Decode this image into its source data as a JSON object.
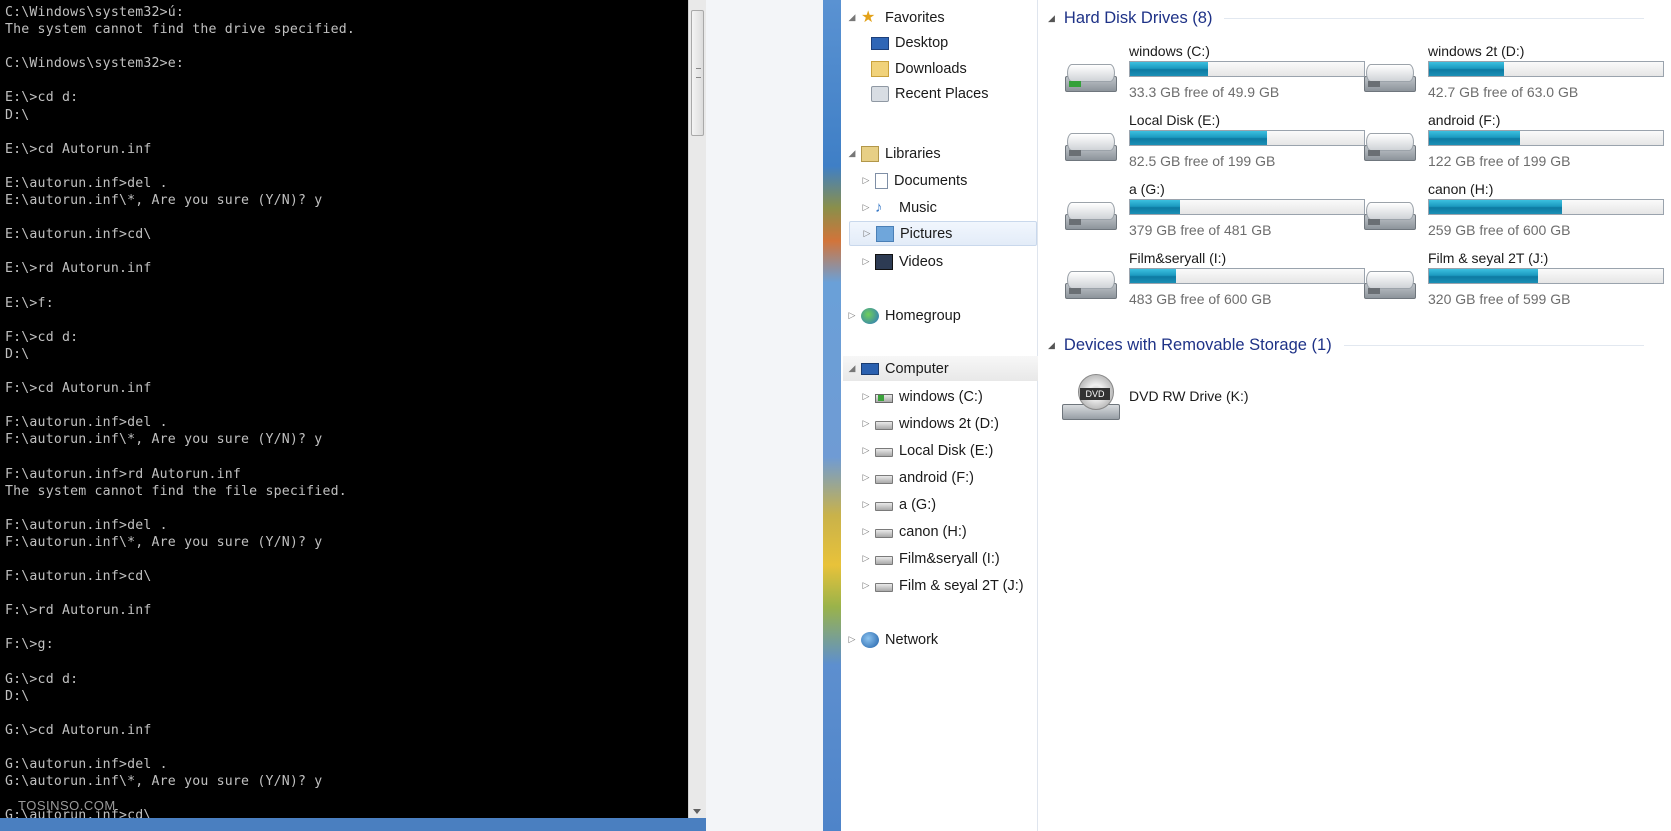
{
  "console": {
    "lines": [
      "C:\\Windows\\system32>ú:",
      "The system cannot find the drive specified.",
      "",
      "C:\\Windows\\system32>e:",
      "",
      "E:\\>cd d:",
      "D:\\",
      "",
      "E:\\>cd Autorun.inf",
      "",
      "E:\\autorun.inf>del .",
      "E:\\autorun.inf\\*, Are you sure (Y/N)? y",
      "",
      "E:\\autorun.inf>cd\\",
      "",
      "E:\\>rd Autorun.inf",
      "",
      "E:\\>f:",
      "",
      "F:\\>cd d:",
      "D:\\",
      "",
      "F:\\>cd Autorun.inf",
      "",
      "F:\\autorun.inf>del .",
      "F:\\autorun.inf\\*, Are you sure (Y/N)? y",
      "",
      "F:\\autorun.inf>rd Autorun.inf",
      "The system cannot find the file specified.",
      "",
      "F:\\autorun.inf>del .",
      "F:\\autorun.inf\\*, Are you sure (Y/N)? y",
      "",
      "F:\\autorun.inf>cd\\",
      "",
      "F:\\>rd Autorun.inf",
      "",
      "F:\\>g:",
      "",
      "G:\\>cd d:",
      "D:\\",
      "",
      "G:\\>cd Autorun.inf",
      "",
      "G:\\autorun.inf>del .",
      "G:\\autorun.inf\\*, Are you sure (Y/N)? y",
      "",
      "G:\\autorun.inf>cd\\"
    ],
    "watermark": "TOSINSO.COM"
  },
  "nav": {
    "favorites": {
      "label": "Favorites",
      "items": [
        "Desktop",
        "Downloads",
        "Recent Places"
      ]
    },
    "libraries": {
      "label": "Libraries",
      "items": [
        "Documents",
        "Music",
        "Pictures",
        "Videos"
      ]
    },
    "homegroup": "Homegroup",
    "computer": {
      "label": "Computer",
      "items": [
        "windows (C:)",
        "windows 2t (D:)",
        "Local Disk (E:)",
        "android (F:)",
        "a (G:)",
        "canon (H:)",
        "Film&seryall (I:)",
        "Film & seyal 2T (J:)"
      ]
    },
    "network": "Network"
  },
  "content": {
    "hdd_group": "Hard Disk Drives (8)",
    "drives": [
      {
        "name": "windows (C:)",
        "free_text": "33.3 GB free of 49.9 GB",
        "used_fraction": 0.333
      },
      {
        "name": "windows 2t (D:)",
        "free_text": "42.7 GB free of 63.0 GB",
        "used_fraction": 0.322
      },
      {
        "name": "Local Disk (E:)",
        "free_text": "82.5 GB free of 199 GB",
        "used_fraction": 0.585
      },
      {
        "name": "android (F:)",
        "free_text": "122 GB free of 199 GB",
        "used_fraction": 0.387
      },
      {
        "name": "a (G:)",
        "free_text": "379 GB free of 481 GB",
        "used_fraction": 0.212
      },
      {
        "name": "canon (H:)",
        "free_text": "259 GB free of 600 GB",
        "used_fraction": 0.568
      },
      {
        "name": "Film&seryall (I:)",
        "free_text": "483 GB free of 600 GB",
        "used_fraction": 0.195
      },
      {
        "name": "Film & seyal 2T (J:)",
        "free_text": "320 GB free of 599 GB",
        "used_fraction": 0.466
      }
    ],
    "removable_group": "Devices with Removable Storage (1)",
    "dvd": {
      "name": "DVD RW Drive (K:)",
      "icon_text": "DVD"
    }
  }
}
